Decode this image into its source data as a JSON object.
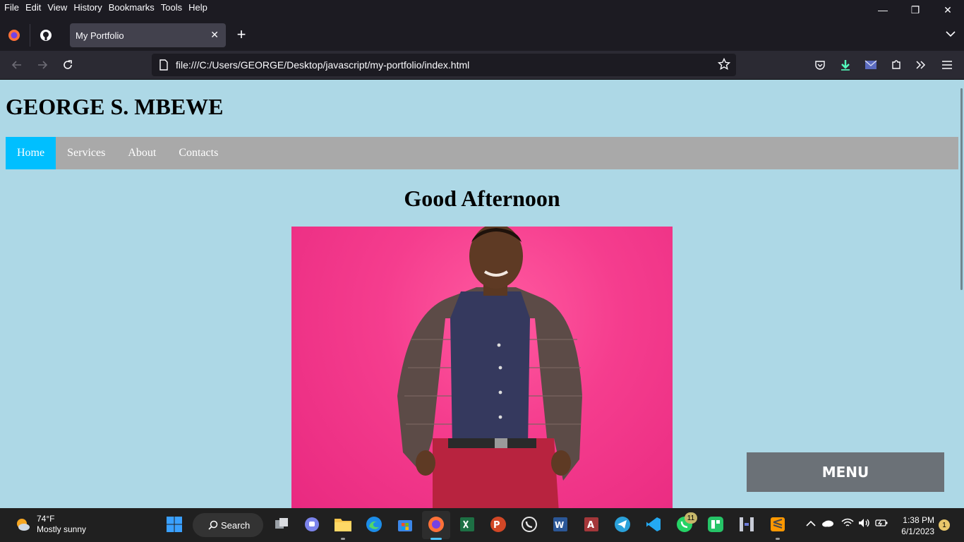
{
  "menubar": {
    "items": [
      "File",
      "Edit",
      "View",
      "History",
      "Bookmarks",
      "Tools",
      "Help"
    ]
  },
  "window_controls": {
    "minimize": "—",
    "restore": "❐",
    "close": "✕"
  },
  "tabs": [
    {
      "title": "My Portfolio"
    }
  ],
  "address_bar": {
    "url": "file:///C:/Users/GEORGE/Desktop/javascript/my-portfolio/index.html"
  },
  "page": {
    "site_title": "GEORGE S. MBEWE",
    "nav": [
      "Home",
      "Services",
      "About",
      "Contacts"
    ],
    "active_nav": "Home",
    "greeting": "Good Afternoon",
    "menu_button": "MENU",
    "colors": {
      "background": "#add8e6",
      "nav_bar": "#a9a9a9",
      "nav_active": "#00bfff",
      "menu_button": "#6b7177",
      "photo_background": "#f0408c"
    }
  },
  "taskbar": {
    "weather_temp": "74°F",
    "weather_desc": "Mostly sunny",
    "search_label": "Search",
    "whatsapp_badge": "11",
    "time": "1:38 PM",
    "date": "6/1/2023",
    "notification_count": "1"
  }
}
